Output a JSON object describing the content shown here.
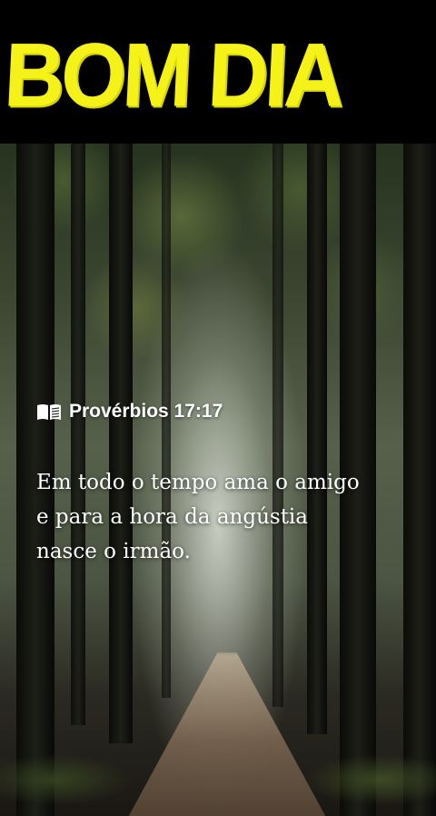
{
  "header": {
    "headline": "BOM DIA",
    "headline_color": "#f5f21a",
    "background_color": "#000000"
  },
  "verse": {
    "icon": "open-book-icon",
    "reference": "Provérbios 17:17",
    "text": "Em todo o tempo ama o amigo\ne para a hora da angústia\nnasce o irmão."
  },
  "background": {
    "scene": "forest path in mist"
  }
}
